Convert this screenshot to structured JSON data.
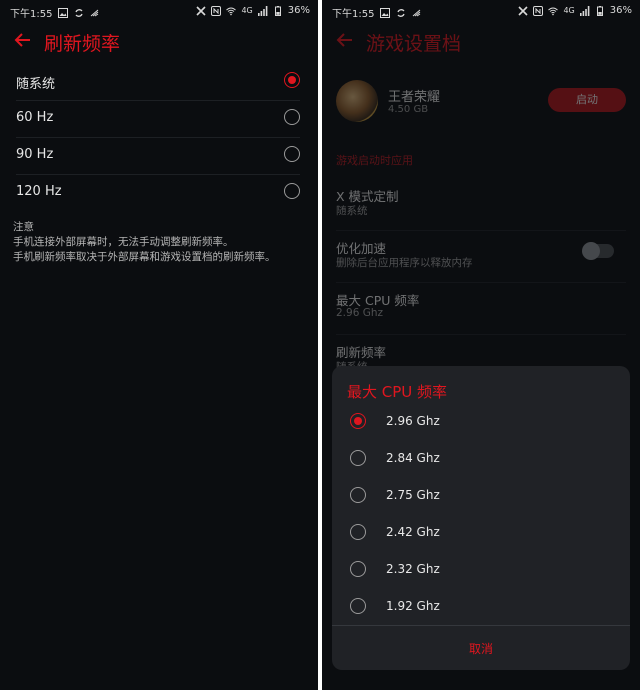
{
  "status": {
    "time": "下午1:55",
    "battery": "36%",
    "network": "4G"
  },
  "left": {
    "title": "刷新频率",
    "options": [
      {
        "label": "随系统",
        "selected": true
      },
      {
        "label": "60 Hz",
        "selected": false
      },
      {
        "label": "90 Hz",
        "selected": false
      },
      {
        "label": "120 Hz",
        "selected": false
      }
    ],
    "note_title": "注意",
    "note_lines": [
      "手机连接外部屏幕时，无法手动调整刷新频率。",
      "手机刷新频率取决于外部屏幕和游戏设置档的刷新频率。"
    ]
  },
  "right": {
    "title": "游戏设置档",
    "game": {
      "name": "王者荣耀",
      "size": "4.50 GB",
      "start_label": "启动"
    },
    "section_label": "游戏启动时应用",
    "items": [
      {
        "title": "X 模式定制",
        "subtitle": "随系统"
      },
      {
        "title": "优化加速",
        "subtitle": "删除后台应用程序以释放内存",
        "toggle": false
      },
      {
        "title": "最大 CPU 频率",
        "subtitle": "2.96 Ghz"
      },
      {
        "title": "刷新频率",
        "subtitle": "随系统"
      }
    ],
    "sheet": {
      "title": "最大 CPU 频率",
      "options": [
        {
          "label": "2.96 Ghz",
          "selected": true
        },
        {
          "label": "2.84 Ghz",
          "selected": false
        },
        {
          "label": "2.75 Ghz",
          "selected": false
        },
        {
          "label": "2.42 Ghz",
          "selected": false
        },
        {
          "label": "2.32 Ghz",
          "selected": false
        },
        {
          "label": "1.92 Ghz",
          "selected": false
        }
      ],
      "cancel_label": "取消"
    }
  },
  "colors": {
    "accent": "#e0161f",
    "background": "#0b0d10",
    "sheet": "#202226"
  }
}
